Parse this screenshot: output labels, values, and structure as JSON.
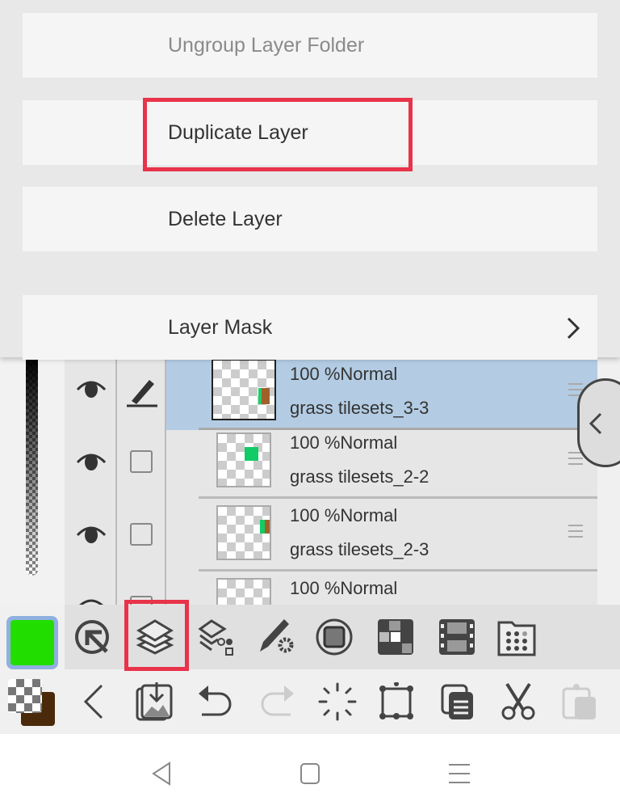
{
  "context_menu": {
    "items": [
      {
        "label": "Ungroup Layer Folder",
        "disabled": true
      },
      {
        "label": "Duplicate Layer",
        "highlighted": true
      },
      {
        "label": "Delete Layer"
      },
      {
        "label": "Layer Mask",
        "has_submenu": true
      }
    ]
  },
  "layers": [
    {
      "opacity": "100 %",
      "blend": "Normal",
      "text": "100 %Normal",
      "name": "grass tilesets_3-3",
      "selected": true,
      "visible": true
    },
    {
      "opacity": "100 %",
      "blend": "Normal",
      "text": "100 %Normal",
      "name": "grass tilesets_2-2",
      "visible": true
    },
    {
      "opacity": "100 %",
      "blend": "Normal",
      "text": "100 %Normal",
      "name": "grass tilesets_2-3",
      "visible": true
    },
    {
      "opacity": "100 %",
      "blend": "Normal",
      "text": "100 %Normal",
      "name": "",
      "visible": true
    }
  ],
  "colors": {
    "foreground": "#22dd00",
    "background": "#4a2a0a",
    "highlight": "#e8334a",
    "selected_row": "#b3cce3"
  },
  "toolbar1": [
    "color-swatch",
    "quick-access-icon",
    "layers-icon",
    "material-icon",
    "brush-settings-icon",
    "canvas-icon",
    "tile-icon",
    "film-icon",
    "folder-icon"
  ],
  "toolbar2": [
    "color-swap",
    "back-icon",
    "import-icon",
    "undo-icon",
    "redo-icon",
    "deselect-icon",
    "transform-icon",
    "copy-icon",
    "cut-icon",
    "paste-icon"
  ],
  "nav": [
    "back",
    "home",
    "menu"
  ]
}
